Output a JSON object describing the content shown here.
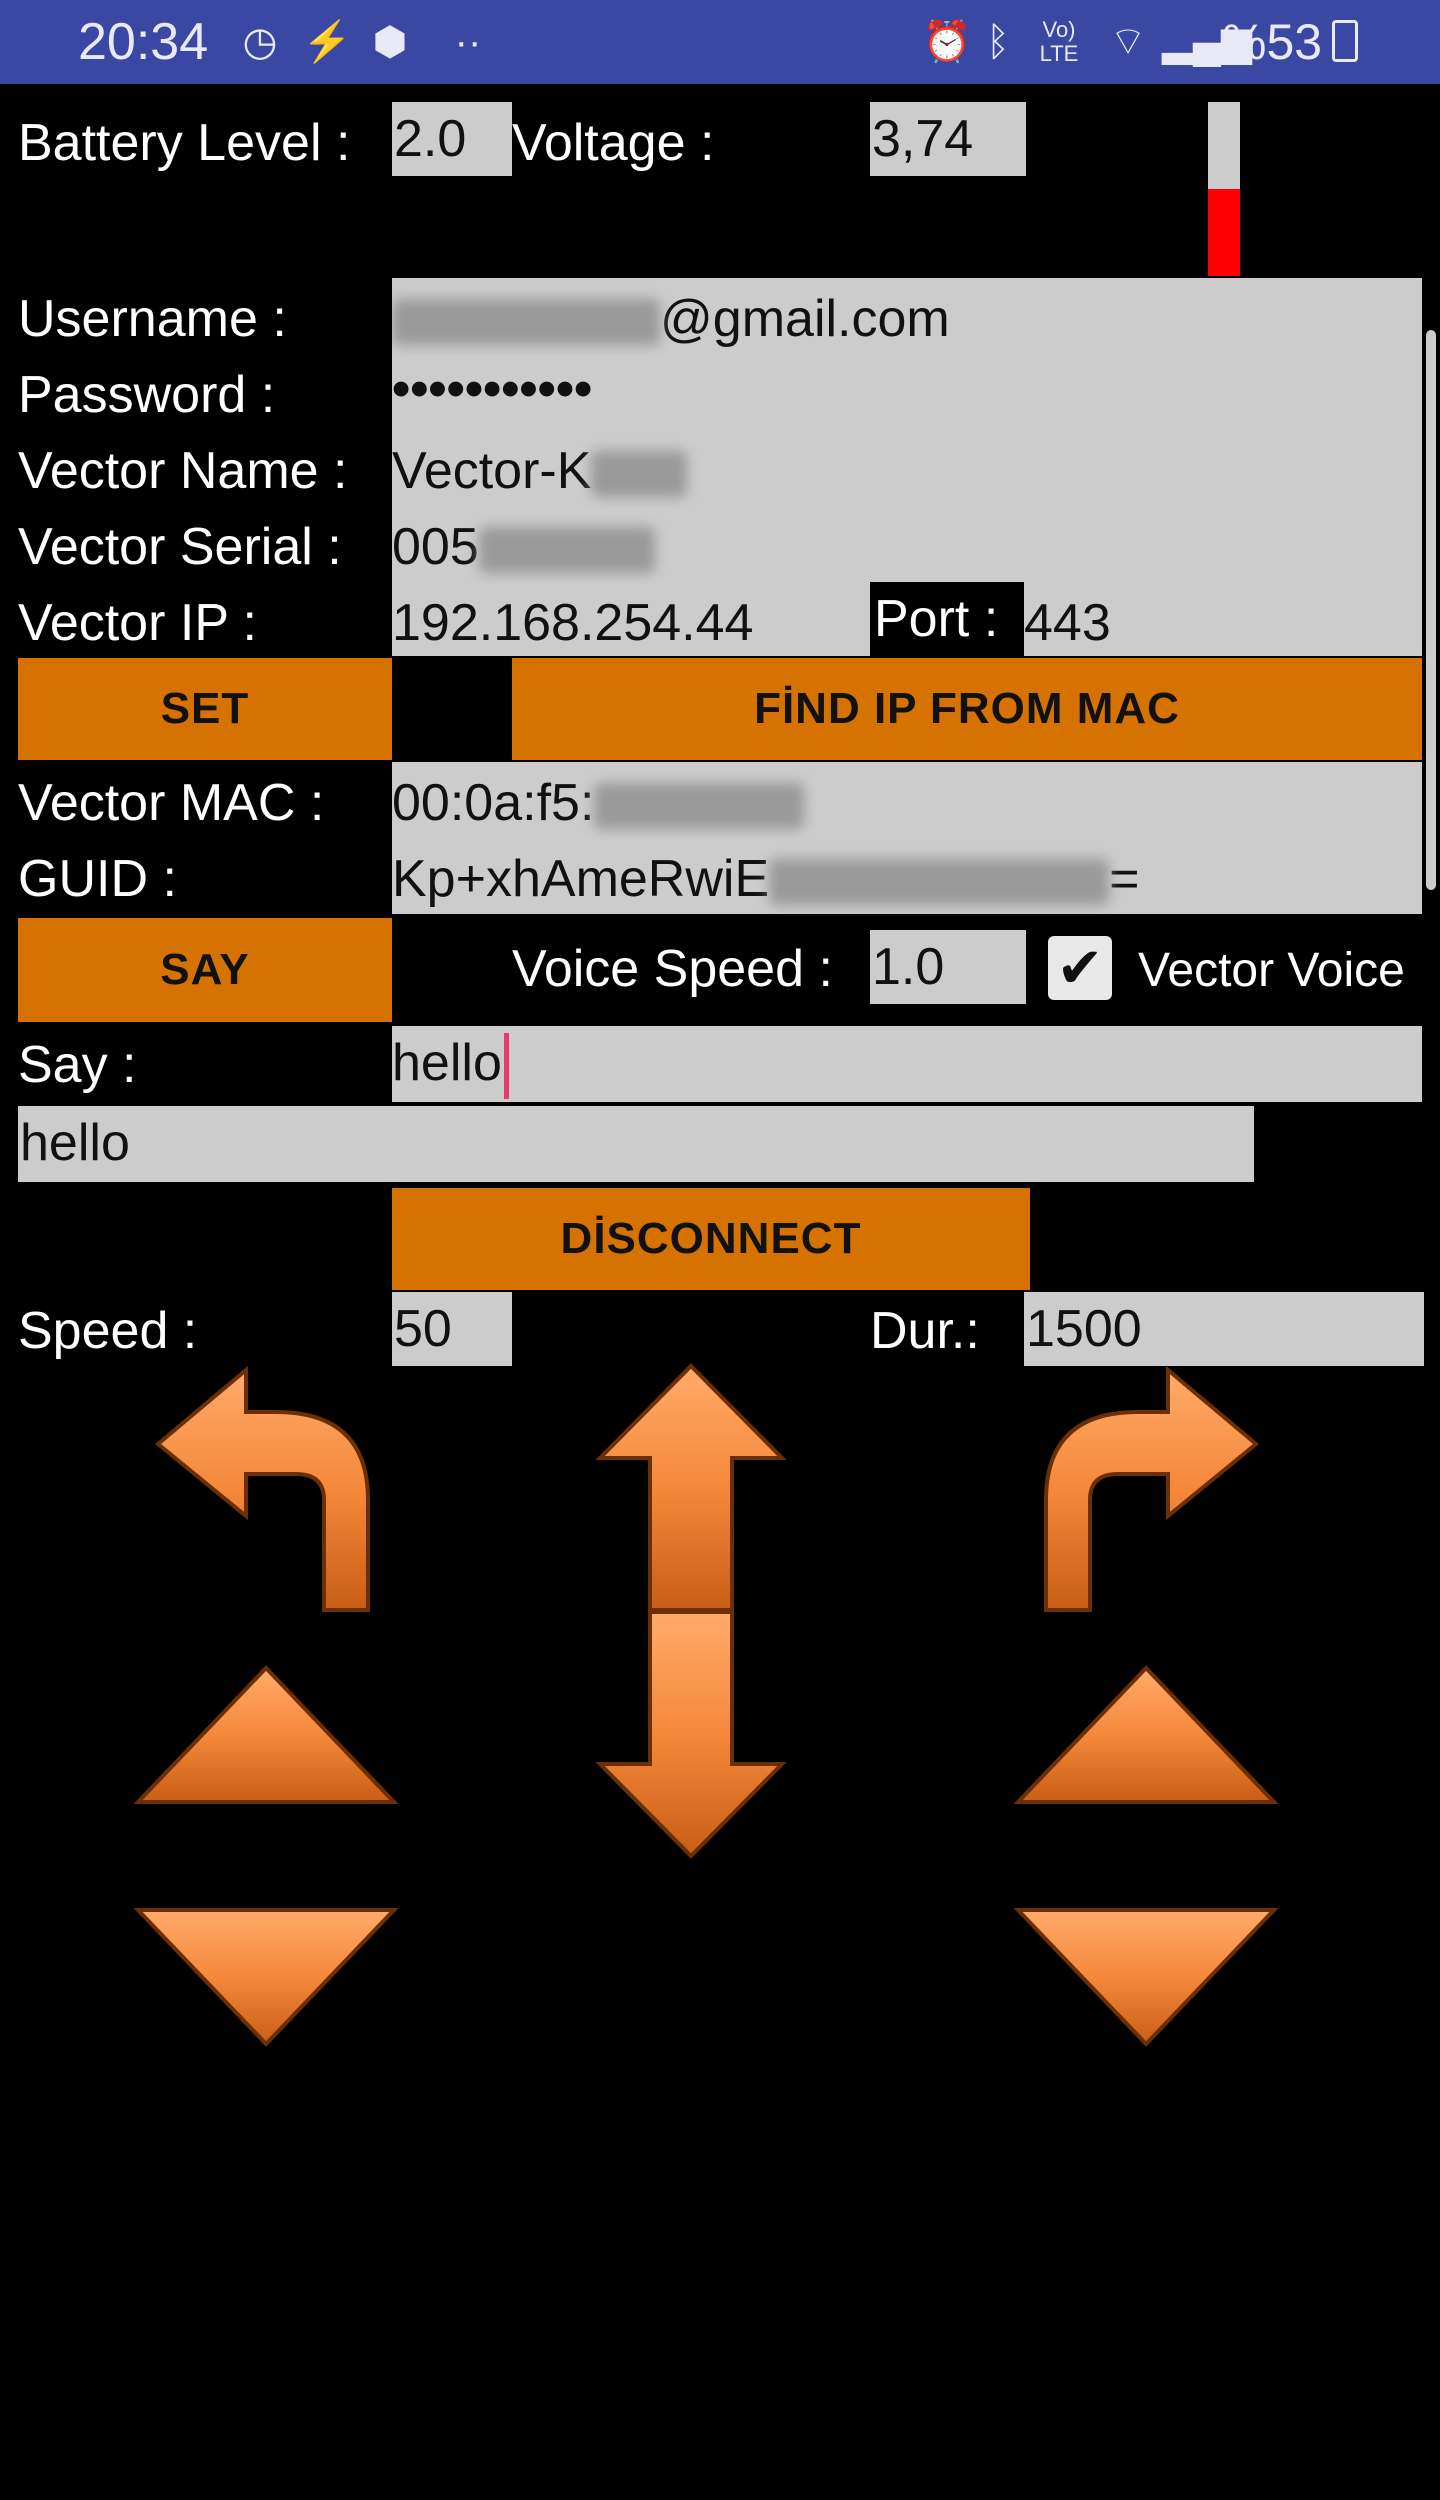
{
  "status_bar": {
    "time": "20:34",
    "battery_percent": "%53"
  },
  "battery": {
    "label": "Battery Level :",
    "value": "2.0",
    "voltage_label": "Voltage :",
    "voltage_value": "3,74",
    "gauge_level": 0.5,
    "gauge_color": "#ff0000"
  },
  "account": {
    "username_label": "Username :",
    "username_suffix": "@gmail.com",
    "password_label": "Password :",
    "password_value": "•••••••••••",
    "vector_name_label": "Vector Name :",
    "vector_name_value": "Vector-K",
    "vector_serial_label": "Vector Serial :",
    "vector_serial_value": "005",
    "vector_ip_label": "Vector IP :",
    "vector_ip_value": "192.168.254.44",
    "port_label": "Port :",
    "port_value": "443"
  },
  "buttons": {
    "set": "SET",
    "find_ip": "FİND IP FROM MAC",
    "say": "SAY",
    "disconnect": "DİSCONNECT"
  },
  "device": {
    "mac_label": "Vector MAC :",
    "mac_value": "00:0a:f5:",
    "guid_label": "GUID :",
    "guid_value": "Kp+xhAmeRwiE",
    "guid_suffix": "="
  },
  "voice": {
    "speed_label": "Voice Speed :",
    "speed_value": "1.0",
    "vector_voice_label": "Vector Voice",
    "vector_voice_checked": true
  },
  "say": {
    "label": "Say :",
    "input_value": "hello",
    "output_value": "hello"
  },
  "motion": {
    "speed_label": "Speed :",
    "speed_value": "50",
    "dur_label": "Dur.:",
    "dur_value": "1500"
  },
  "colors": {
    "accent": "#d67300",
    "arrow_fill": "#f5883a",
    "field_bg": "#cccccc",
    "status_bar": "#3a47a3"
  }
}
